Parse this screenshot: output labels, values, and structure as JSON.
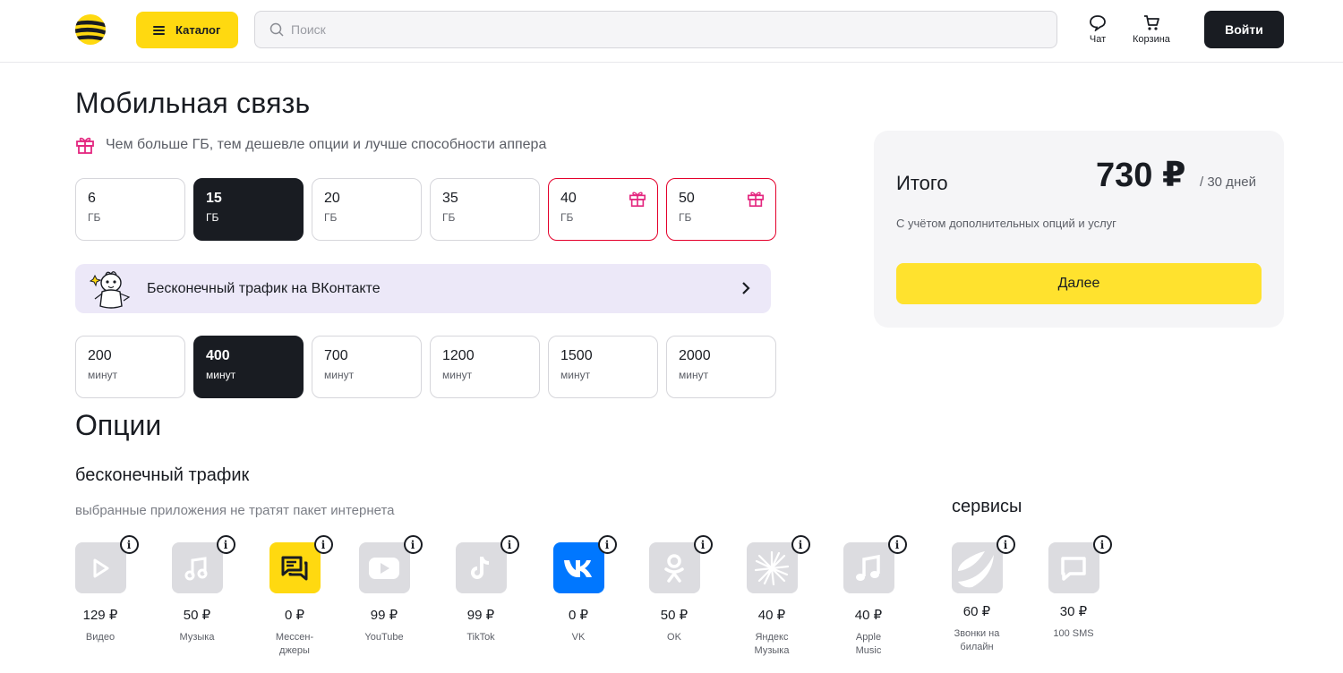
{
  "header": {
    "catalog_label": "Каталог",
    "search_placeholder": "Поиск",
    "chat_label": "Чат",
    "cart_label": "Корзина",
    "login_label": "Войти"
  },
  "page": {
    "title": "Мобильная связь",
    "promo_text": "Чем больше ГБ, тем дешевле опции и лучше способности аппера"
  },
  "gb_options": [
    {
      "value": "6",
      "unit": "ГБ",
      "selected": false,
      "gift": false
    },
    {
      "value": "15",
      "unit": "ГБ",
      "selected": true,
      "gift": false
    },
    {
      "value": "20",
      "unit": "ГБ",
      "selected": false,
      "gift": false
    },
    {
      "value": "35",
      "unit": "ГБ",
      "selected": false,
      "gift": false
    },
    {
      "value": "40",
      "unit": "ГБ",
      "selected": false,
      "gift": true
    },
    {
      "value": "50",
      "unit": "ГБ",
      "selected": false,
      "gift": true
    }
  ],
  "vk_banner": {
    "text": "Бесконечный трафик на ВКонтакте"
  },
  "minute_options": [
    {
      "value": "200",
      "unit": "минут",
      "selected": false
    },
    {
      "value": "400",
      "unit": "минут",
      "selected": true
    },
    {
      "value": "700",
      "unit": "минут",
      "selected": false
    },
    {
      "value": "1200",
      "unit": "минут",
      "selected": false
    },
    {
      "value": "1500",
      "unit": "минут",
      "selected": false
    },
    {
      "value": "2000",
      "unit": "минут",
      "selected": false
    }
  ],
  "options": {
    "title": "Опции",
    "traffic_title": "бесконечный трафик",
    "traffic_subtitle": "выбранные приложения не тратят пакет интернета",
    "services_title": "сервисы",
    "apps": [
      {
        "price": "129 ₽",
        "name": "Видео",
        "icon": "video-play-icon"
      },
      {
        "price": "50 ₽",
        "name": "Музыка",
        "icon": "music-note-icon"
      },
      {
        "price": "0 ₽",
        "name": "Мессен-\nджеры",
        "icon": "messenger-icon"
      },
      {
        "price": "99 ₽",
        "name": "YouTube",
        "icon": "youtube-icon"
      },
      {
        "price": "99 ₽",
        "name": "TikTok",
        "icon": "tiktok-icon"
      },
      {
        "price": "0 ₽",
        "name": "VK",
        "icon": "vk-icon"
      },
      {
        "price": "50 ₽",
        "name": "OK",
        "icon": "ok-icon"
      },
      {
        "price": "40 ₽",
        "name": "Яндекс\nМузыка",
        "icon": "yandex-music-icon"
      },
      {
        "price": "40 ₽",
        "name": "Apple\nMusic",
        "icon": "apple-music-icon"
      }
    ],
    "services": [
      {
        "price": "60 ₽",
        "name": "Звонки на\nбилайн",
        "icon": "beeline-calls-icon"
      },
      {
        "price": "30 ₽",
        "name": "100 SMS",
        "icon": "sms-icon"
      }
    ]
  },
  "summary": {
    "title": "Итого",
    "price": "730 ₽",
    "period": "/ 30 дней",
    "note": "С учётом дополнительных опций и услуг",
    "next_label": "Далее"
  },
  "colors": {
    "brand_yellow": "#ffd910",
    "dark": "#191c22",
    "gift_pink": "#e4267f",
    "gift_border": "#e4002b",
    "vk_blue": "#0077ff",
    "banner_bg": "#ece8f8"
  }
}
